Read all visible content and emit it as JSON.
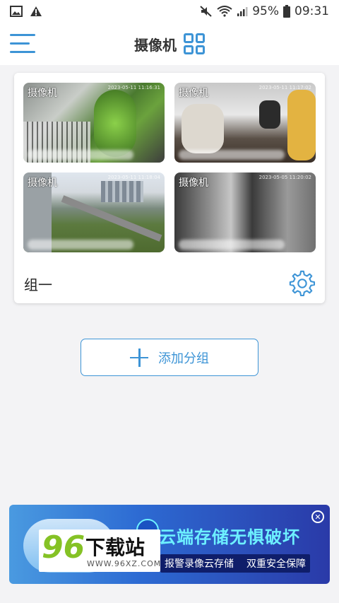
{
  "status_bar": {
    "battery": "95%",
    "time": "09:31",
    "icons": [
      "image-icon",
      "warning-icon",
      "mute-icon",
      "wifi-icon",
      "signal-icon",
      "battery-icon"
    ]
  },
  "header": {
    "title": "摄像机",
    "icons": [
      "menu-icon",
      "grid-view-icon"
    ],
    "accent_color": "#3d94d6"
  },
  "group": {
    "name": "组一",
    "cameras": [
      {
        "label": "摄像机",
        "timestamp": "2023-05-11 11:16:31"
      },
      {
        "label": "摄像机",
        "timestamp": "2023-05-11 11:17:02"
      },
      {
        "label": "摄像机",
        "timestamp": "2023-05-11 11:18:04"
      },
      {
        "label": "摄像机",
        "timestamp": "2023-05-05 11:20:02"
      }
    ],
    "settings_icon": "gear-icon"
  },
  "add_group_label": "添加分组",
  "ad": {
    "headline": "云端存储无惧破坏",
    "sub_left": "报警录像云存储",
    "sub_right": "双重安全保障",
    "close_icon": "close-icon"
  },
  "watermark": {
    "number": "96",
    "name": "下载站",
    "url": "WWW.96XZ.COM"
  }
}
